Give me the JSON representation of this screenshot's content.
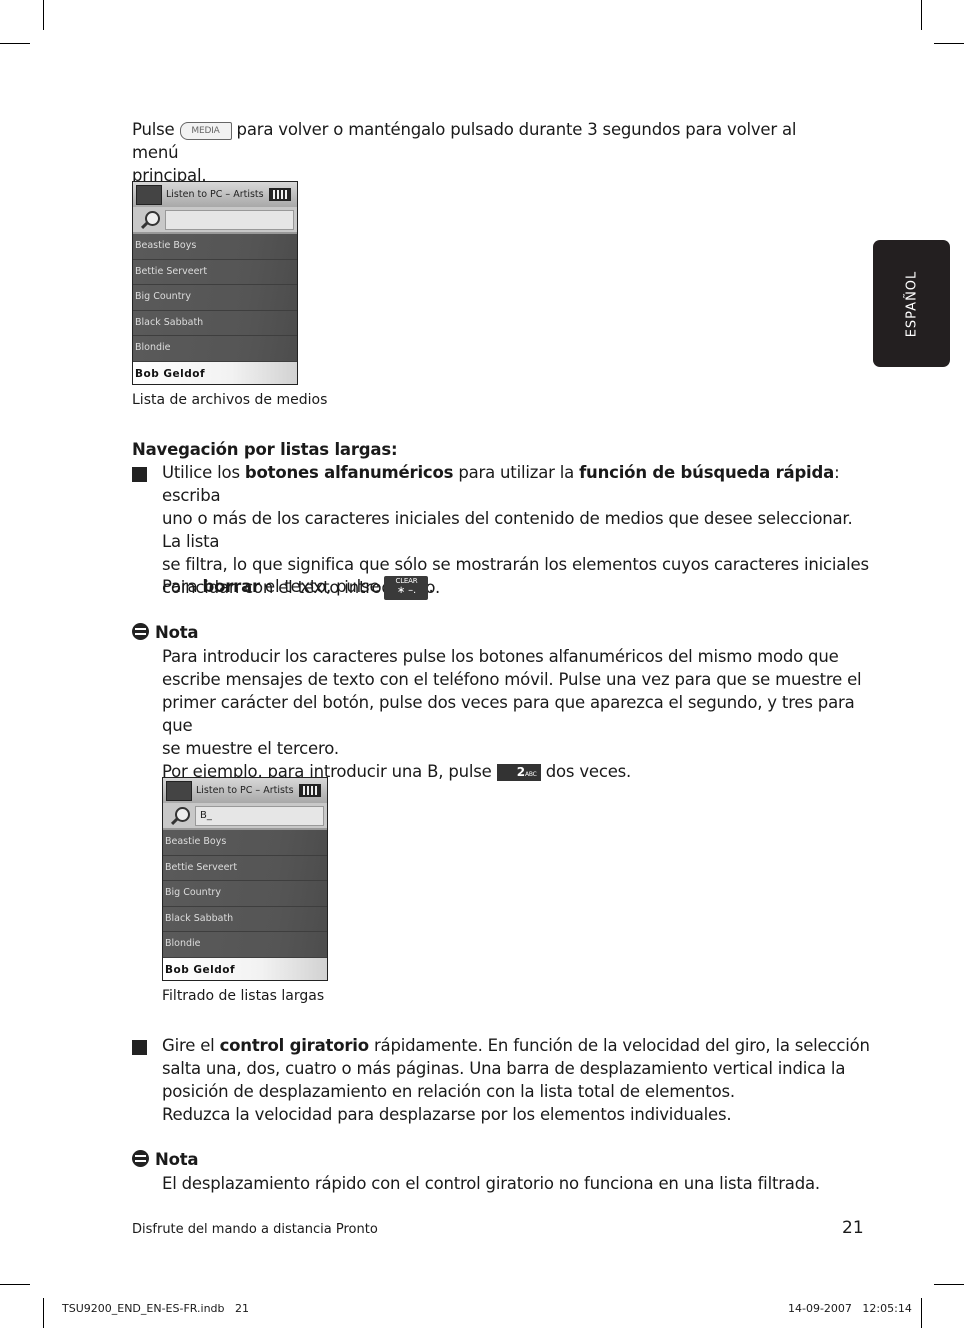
{
  "intro": {
    "before_key": "Pulse",
    "media_key": "MEDIA",
    "after_key": "para volver o manténgalo pulsado durante 3 segundos para volver al menú",
    "line2": "principal."
  },
  "language_tab": "ESPAÑOL",
  "device1": {
    "title": "Listen to PC – Artists",
    "search_value": "",
    "items": [
      "Beastie Boys",
      "Bettie Serveert",
      "Big Country",
      "Black Sabbath",
      "Blondie",
      "Bob Geldof"
    ],
    "selected": "Bob Geldof",
    "caption": "Lista de archivos de medios"
  },
  "section": {
    "heading": "Navegación por listas largas:",
    "bullet1": {
      "p1": "Utilice los ",
      "b1": "botones alfanuméricos",
      "p2": " para utilizar la ",
      "b2": "función de búsqueda rápida",
      "p3": ": escriba",
      "line2": "uno o más de los caracteres iniciales del contenido de medios que desee seleccionar. La lista",
      "line3": "se filtra, lo que significa que sólo se mostrarán los elementos cuyos caracteres iniciales",
      "line4": "coincidan con el texto introducido."
    },
    "clear": {
      "p1": "Para ",
      "b1": "borrar",
      "p2": " el texto, pulse",
      "key_label": "CLEAR",
      "key_symbol": "∗ –.",
      "end": "."
    },
    "note1": {
      "title": "Nota",
      "lines": [
        "Para introducir los caracteres pulse los botones alfanuméricos del mismo modo que",
        "escribe mensajes de texto con el teléfono móvil. Pulse una vez para que se muestre el",
        "primer carácter del botón, pulse dos veces para que aparezca el segundo, y tres para que",
        "se muestre el tercero."
      ],
      "example_before": "Por ejemplo, para introducir una B, pulse",
      "key_digit": "2",
      "key_letters": "ABC",
      "example_after": "dos veces."
    }
  },
  "device2": {
    "title": "Listen to PC – Artists",
    "search_value": "B_",
    "items": [
      "Beastie Boys",
      "Bettie Serveert",
      "Big Country",
      "Black Sabbath",
      "Blondie",
      "Bob Geldof"
    ],
    "selected": "Bob Geldof",
    "caption": "Filtrado de listas largas"
  },
  "bullet2": {
    "p1": "Gire el ",
    "b1": "control giratorio",
    "p2": " rápidamente. En función de la velocidad del giro, la selección",
    "line2": "salta una, dos, cuatro o más páginas. Una barra de desplazamiento vertical indica la",
    "line3": "posición de desplazamiento en relación con la lista total de elementos.",
    "line4": "Reduzca la velocidad para desplazarse por los elementos individuales."
  },
  "note2": {
    "title": "Nota",
    "text": "El desplazamiento rápido con el control giratorio no funciona en una lista filtrada."
  },
  "footer": {
    "left": "Disfrute del mando a distancia Pronto",
    "page_number": "21"
  },
  "slug": {
    "file": "TSU9200_END_EN-ES-FR.indb   21",
    "timestamp": "14-09-2007   12:05:14"
  }
}
